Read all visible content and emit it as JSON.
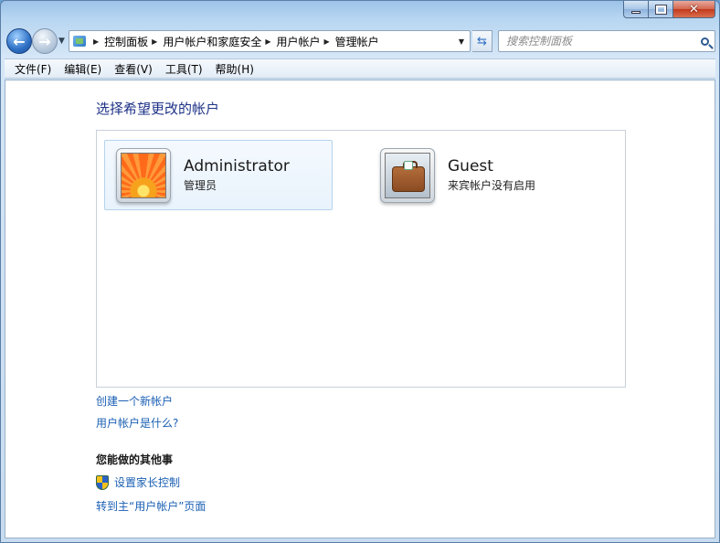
{
  "window": {
    "caption": {
      "minimize": "",
      "maximize": "",
      "close": "✕"
    }
  },
  "nav": {
    "back": "←",
    "forward": "→",
    "breadcrumbs": [
      "控制面板",
      "用户帐户和家庭安全",
      "用户帐户",
      "管理帐户"
    ],
    "search_placeholder": "搜索控制面板"
  },
  "menu": {
    "items": [
      "文件(F)",
      "编辑(E)",
      "查看(V)",
      "工具(T)",
      "帮助(H)"
    ]
  },
  "main": {
    "heading": "选择希望更改的帐户",
    "accounts": [
      {
        "name": "Administrator",
        "role": "管理员",
        "avatar": "flower-avatar",
        "selected": true
      },
      {
        "name": "Guest",
        "role": "来宾帐户没有启用",
        "avatar": "suitcase-avatar",
        "selected": false
      }
    ],
    "links": {
      "create": "创建一个新帐户",
      "what": "用户帐户是什么?"
    },
    "other_section": {
      "title": "您能做的其他事",
      "parental": "设置家长控制",
      "goto_main": "转到主“用户帐户”页面"
    }
  },
  "colors": {
    "link": "#1a5fb4",
    "heading": "#1e3287"
  }
}
